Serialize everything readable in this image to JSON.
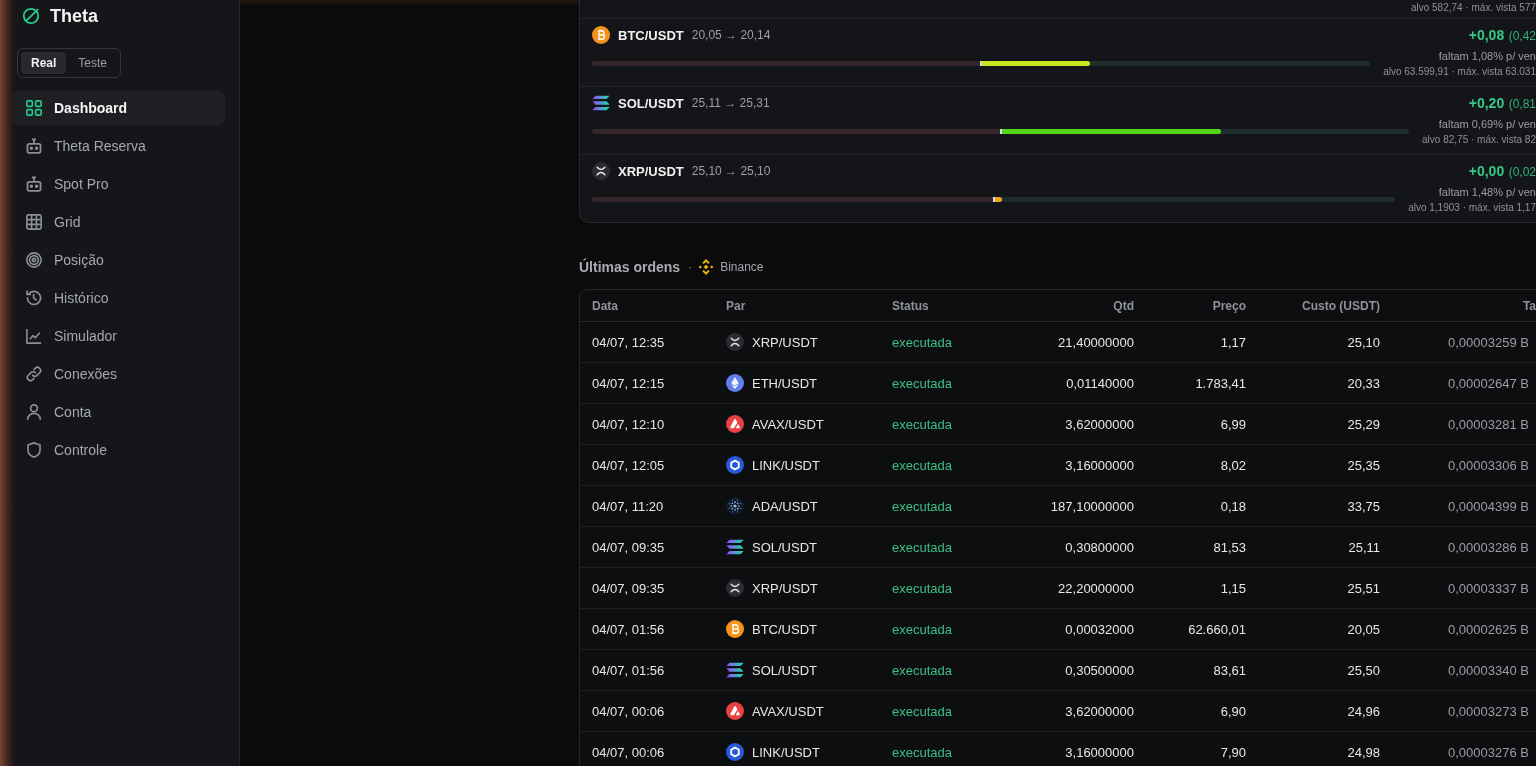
{
  "sidebar": {
    "brand": "Theta",
    "mode_toggle": [
      {
        "label": "Real",
        "selected": true
      },
      {
        "label": "Teste",
        "selected": false
      }
    ],
    "items": [
      {
        "label": "Dashboard",
        "kind": "squares",
        "selected": true
      },
      {
        "label": "Theta Reserva",
        "kind": "robot",
        "selected": false
      },
      {
        "label": "Spot Pro",
        "kind": "robot",
        "selected": false
      },
      {
        "label": "Grid",
        "kind": "grid",
        "selected": false
      },
      {
        "label": "Posição",
        "kind": "target",
        "selected": false
      },
      {
        "label": "Histórico",
        "kind": "history",
        "selected": false
      },
      {
        "label": "Simulador",
        "kind": "chart",
        "selected": false
      },
      {
        "label": "Conexões",
        "kind": "link",
        "selected": false
      },
      {
        "label": "Conta",
        "kind": "user",
        "selected": false
      },
      {
        "label": "Controle",
        "kind": "shield",
        "selected": false
      }
    ]
  },
  "positions": {
    "top_row": {
      "target_line": "alvo 582,74 · máx. vista 577"
    },
    "items": [
      {
        "kind": "btc",
        "pair": "BTC/USDT",
        "prices": "20,05 → 20,14",
        "pnl": "+0,08",
        "pnl_pct": "(0,42",
        "remaining": "faltam 1,08% p/ ven",
        "target_line": "alvo 63.599,91 · máx. vista 63.031",
        "level": 0.28,
        "color": "#c8e61c"
      },
      {
        "kind": "sol",
        "pair": "SOL/USDT",
        "prices": "25,11 → 25,31",
        "pnl": "+0,20",
        "pnl_pct": "(0,81",
        "remaining": "faltam 0,69% p/ ven",
        "target_line": "alvo 82,75 · máx. vista 82",
        "level": 0.54,
        "color": "#52d61a"
      },
      {
        "kind": "xrp",
        "pair": "XRP/USDT",
        "prices": "25,10 → 25,10",
        "pnl": "+0,00",
        "pnl_pct": "(0,02",
        "remaining": "faltam 1,48% p/ ven",
        "target_line": "alvo 1,1903 · máx. vista 1,17",
        "level": 0.02,
        "color": "#f0a41c"
      }
    ]
  },
  "orders": {
    "title": "Últimas ordens",
    "separator": "·",
    "exchange": "Binance",
    "columns": [
      "Data",
      "Par",
      "Status",
      "Qtd",
      "Preço",
      "Custo (USDT)",
      "Ta"
    ],
    "rows": [
      {
        "date": "04/07, 12:35",
        "kind": "xrp",
        "pair": "XRP/USDT",
        "status": "executada",
        "qty": "21,40000000",
        "price": "1,17",
        "cost": "25,10",
        "fee": "0,00003259 B"
      },
      {
        "date": "04/07, 12:15",
        "kind": "eth",
        "pair": "ETH/USDT",
        "status": "executada",
        "qty": "0,01140000",
        "price": "1.783,41",
        "cost": "20,33",
        "fee": "0,00002647 B"
      },
      {
        "date": "04/07, 12:10",
        "kind": "avax",
        "pair": "AVAX/USDT",
        "status": "executada",
        "qty": "3,62000000",
        "price": "6,99",
        "cost": "25,29",
        "fee": "0,00003281 B"
      },
      {
        "date": "04/07, 12:05",
        "kind": "link",
        "pair": "LINK/USDT",
        "status": "executada",
        "qty": "3,16000000",
        "price": "8,02",
        "cost": "25,35",
        "fee": "0,00003306 B"
      },
      {
        "date": "04/07, 11:20",
        "kind": "ada",
        "pair": "ADA/USDT",
        "status": "executada",
        "qty": "187,10000000",
        "price": "0,18",
        "cost": "33,75",
        "fee": "0,00004399 B"
      },
      {
        "date": "04/07, 09:35",
        "kind": "sol",
        "pair": "SOL/USDT",
        "status": "executada",
        "qty": "0,30800000",
        "price": "81,53",
        "cost": "25,11",
        "fee": "0,00003286 B"
      },
      {
        "date": "04/07, 09:35",
        "kind": "xrp",
        "pair": "XRP/USDT",
        "status": "executada",
        "qty": "22,20000000",
        "price": "1,15",
        "cost": "25,51",
        "fee": "0,00003337 B"
      },
      {
        "date": "04/07, 01:56",
        "kind": "btc",
        "pair": "BTC/USDT",
        "status": "executada",
        "qty": "0,00032000",
        "price": "62.660,01",
        "cost": "20,05",
        "fee": "0,00002625 B"
      },
      {
        "date": "04/07, 01:56",
        "kind": "sol",
        "pair": "SOL/USDT",
        "status": "executada",
        "qty": "0,30500000",
        "price": "83,61",
        "cost": "25,50",
        "fee": "0,00003340 B"
      },
      {
        "date": "04/07, 00:06",
        "kind": "avax",
        "pair": "AVAX/USDT",
        "status": "executada",
        "qty": "3,62000000",
        "price": "6,90",
        "cost": "24,96",
        "fee": "0,00003273 B"
      },
      {
        "date": "04/07, 00:06",
        "kind": "link",
        "pair": "LINK/USDT",
        "status": "executada",
        "qty": "3,16000000",
        "price": "7,90",
        "cost": "24,98",
        "fee": "0,00003276 B"
      }
    ]
  }
}
